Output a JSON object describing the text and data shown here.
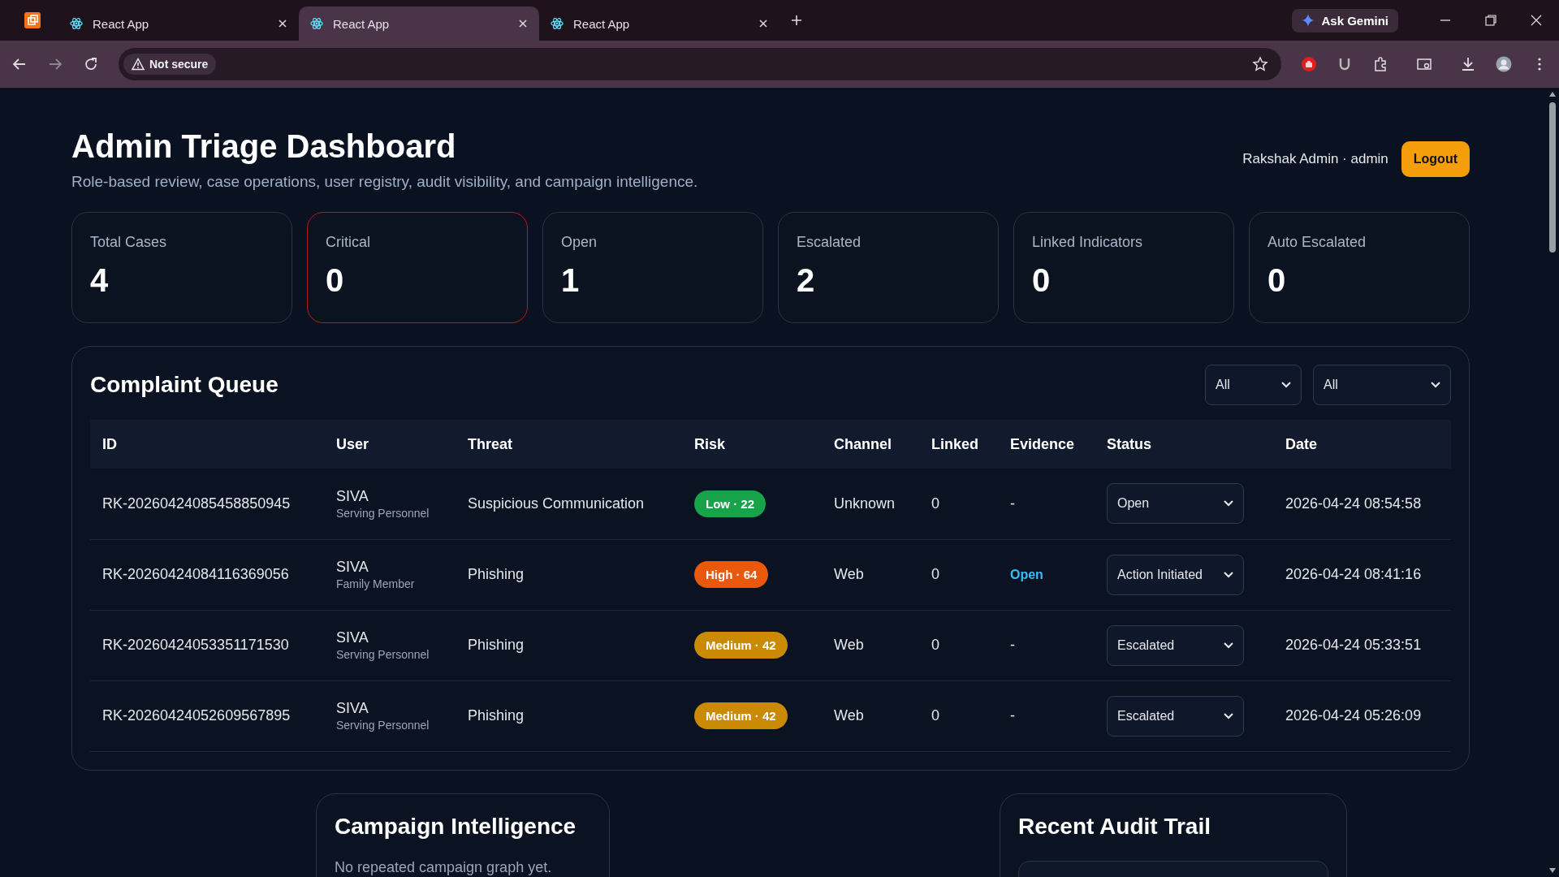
{
  "browser": {
    "tabs": [
      {
        "title": "React App",
        "selected": false
      },
      {
        "title": "React App",
        "selected": true
      },
      {
        "title": "React App",
        "selected": false
      }
    ],
    "security_label": "Not secure",
    "assistant_button": "Ask Gemini"
  },
  "header": {
    "title": "Admin Triage Dashboard",
    "subtitle": "Role-based review, case operations, user registry, audit visibility, and campaign intelligence.",
    "user": "Rakshak Admin · admin",
    "logout": "Logout"
  },
  "stats": [
    {
      "label": "Total Cases",
      "value": "4",
      "alert": false
    },
    {
      "label": "Critical",
      "value": "0",
      "alert": true
    },
    {
      "label": "Open",
      "value": "1",
      "alert": false
    },
    {
      "label": "Escalated",
      "value": "2",
      "alert": false
    },
    {
      "label": "Linked Indicators",
      "value": "0",
      "alert": false
    },
    {
      "label": "Auto Escalated",
      "value": "0",
      "alert": false
    }
  ],
  "queue": {
    "title": "Complaint Queue",
    "filters": [
      "All",
      "All"
    ],
    "columns": [
      "ID",
      "User",
      "Threat",
      "Risk",
      "Channel",
      "Linked",
      "Evidence",
      "Status",
      "Date"
    ],
    "rows": [
      {
        "id": "RK-20260424085458850945",
        "user": "SIVA",
        "role": "Serving Personnel",
        "threat": "Suspicious Communication",
        "risk": "Low · 22",
        "kind": "low",
        "channel": "Unknown",
        "linked": "0",
        "evidence": {
          "kind": "none",
          "text": "-"
        },
        "status": "Open",
        "date": "2026-04-24 08:54:58"
      },
      {
        "id": "RK-20260424084116369056",
        "user": "SIVA",
        "role": "Family Member",
        "threat": "Phishing",
        "risk": "High · 64",
        "kind": "high",
        "channel": "Web",
        "linked": "0",
        "evidence": {
          "kind": "link",
          "text": "Open"
        },
        "status": "Action Initiated",
        "date": "2026-04-24 08:41:16"
      },
      {
        "id": "RK-20260424053351171530",
        "user": "SIVA",
        "role": "Serving Personnel",
        "threat": "Phishing",
        "risk": "Medium · 42",
        "kind": "medium",
        "channel": "Web",
        "linked": "0",
        "evidence": {
          "kind": "none",
          "text": "-"
        },
        "status": "Escalated",
        "date": "2026-04-24 05:33:51"
      },
      {
        "id": "RK-20260424052609567895",
        "user": "SIVA",
        "role": "Serving Personnel",
        "threat": "Phishing",
        "risk": "Medium · 42",
        "kind": "medium",
        "channel": "Web",
        "linked": "0",
        "evidence": {
          "kind": "none",
          "text": "-"
        },
        "status": "Escalated",
        "date": "2026-04-24 05:26:09"
      }
    ]
  },
  "campaign": {
    "title": "Campaign Intelligence",
    "empty_text": "No repeated campaign graph yet."
  },
  "audit": {
    "title": "Recent Audit Trail"
  }
}
